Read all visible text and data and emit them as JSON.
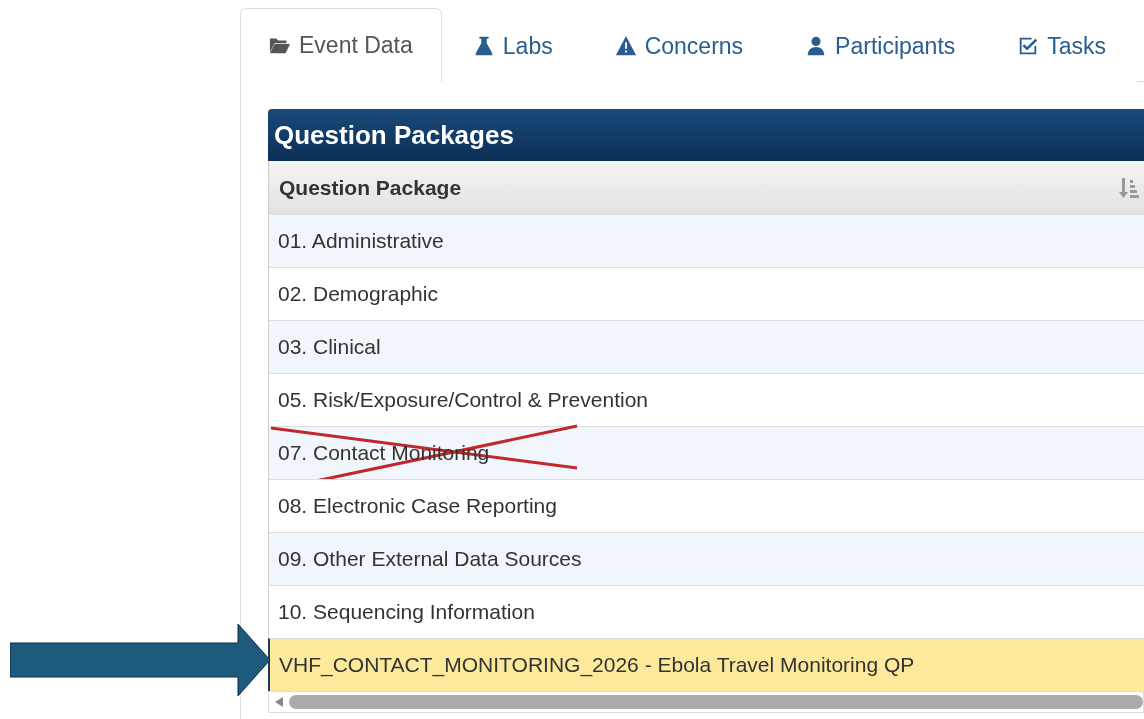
{
  "tabs": [
    {
      "label": "Event Data",
      "selected": true
    },
    {
      "label": "Labs",
      "selected": false
    },
    {
      "label": "Concerns",
      "selected": false
    },
    {
      "label": "Participants",
      "selected": false
    },
    {
      "label": "Tasks",
      "selected": false
    }
  ],
  "panel": {
    "title": "Question Packages"
  },
  "table": {
    "columns": [
      "Question Package"
    ],
    "rows": [
      {
        "label": "01. Administrative",
        "selected": false,
        "crossed_out": false
      },
      {
        "label": "02. Demographic",
        "selected": false,
        "crossed_out": false
      },
      {
        "label": "03. Clinical",
        "selected": false,
        "crossed_out": false
      },
      {
        "label": "05. Risk/Exposure/Control & Prevention",
        "selected": false,
        "crossed_out": false
      },
      {
        "label": "07. Contact Monitoring",
        "selected": false,
        "crossed_out": true
      },
      {
        "label": "08. Electronic Case Reporting",
        "selected": false,
        "crossed_out": false
      },
      {
        "label": "09. Other External Data Sources",
        "selected": false,
        "crossed_out": false
      },
      {
        "label": "10. Sequencing Information",
        "selected": false,
        "crossed_out": false
      },
      {
        "label": "VHF_CONTACT_MONITORING_2026 - Ebola Travel Monitoring QP",
        "selected": true,
        "crossed_out": false
      }
    ]
  }
}
